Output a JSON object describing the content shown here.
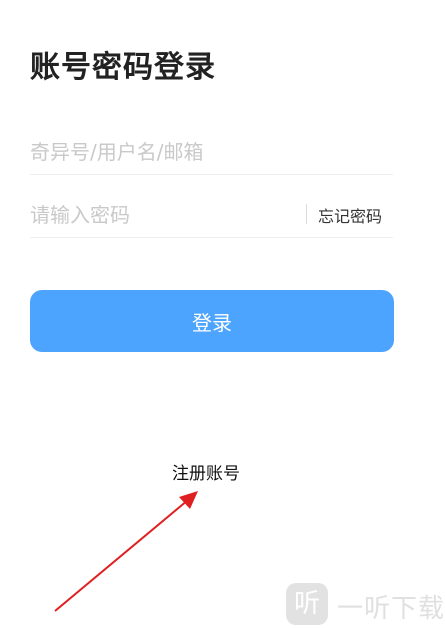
{
  "header": {
    "title": "账号密码登录"
  },
  "form": {
    "username_placeholder": "奇异号/用户名/邮箱",
    "password_placeholder": "请输入密码",
    "forgot_label": "忘记密码",
    "login_label": "登录"
  },
  "register_label": "注册账号",
  "annotation": {
    "arrow_color": "#e02020"
  },
  "colors": {
    "accent": "#4da4ff",
    "placeholder": "#c9c9c9",
    "title": "#222222"
  },
  "watermark": {
    "icon_glyph": "听",
    "text": "一听下载"
  }
}
